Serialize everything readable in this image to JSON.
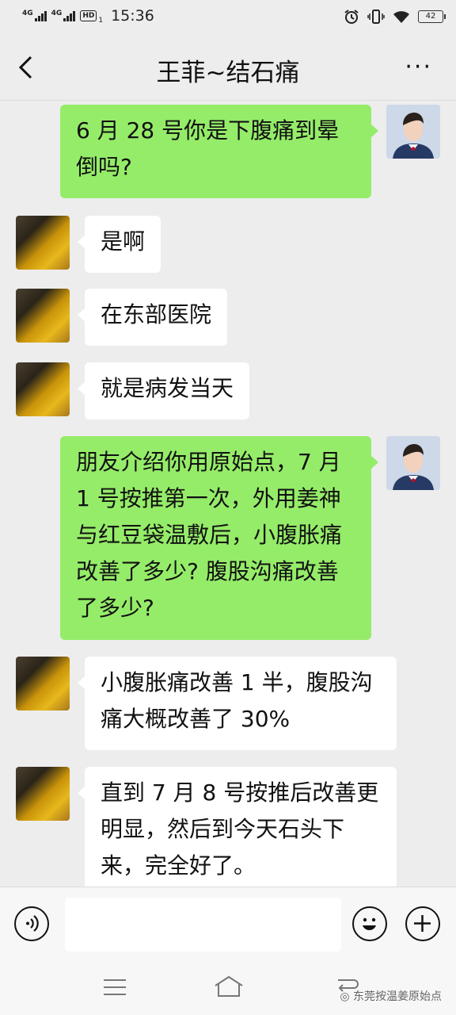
{
  "status_bar": {
    "network_1": "4G",
    "network_2": "4G",
    "hd": "HD",
    "hd_sub": "1",
    "time": "15:36",
    "battery": "42",
    "icons": [
      "alarm-icon",
      "vibrate-icon",
      "wifi-icon",
      "battery-icon"
    ]
  },
  "header": {
    "title": "王菲~结石痛",
    "more": "···"
  },
  "messages": [
    {
      "from": "me",
      "text": "6 月 28 号你是下腹痛到晕倒吗?"
    },
    {
      "from": "other",
      "text": "是啊"
    },
    {
      "from": "other",
      "text": "在东部医院"
    },
    {
      "from": "other",
      "text": "就是病发当天"
    },
    {
      "from": "me",
      "text": "朋友介绍你用原始点，7 月 1 号按推第一次，外用姜神与红豆袋温敷后，小腹胀痛改善了多少? 腹股沟痛改善了多少?"
    },
    {
      "from": "other",
      "text": "小腹胀痛改善 1 半，腹股沟痛大概改善了 30%"
    },
    {
      "from": "other",
      "text": "直到 7 月 8 号按推后改善更明显，然后到今天石头下来，完全好了。"
    }
  ],
  "input": {
    "value": "",
    "placeholder": ""
  },
  "watermark": "东莞按温姜原始点",
  "colors": {
    "sent_bubble": "#95ec69",
    "received_bubble": "#ffffff",
    "background": "#ededed"
  }
}
